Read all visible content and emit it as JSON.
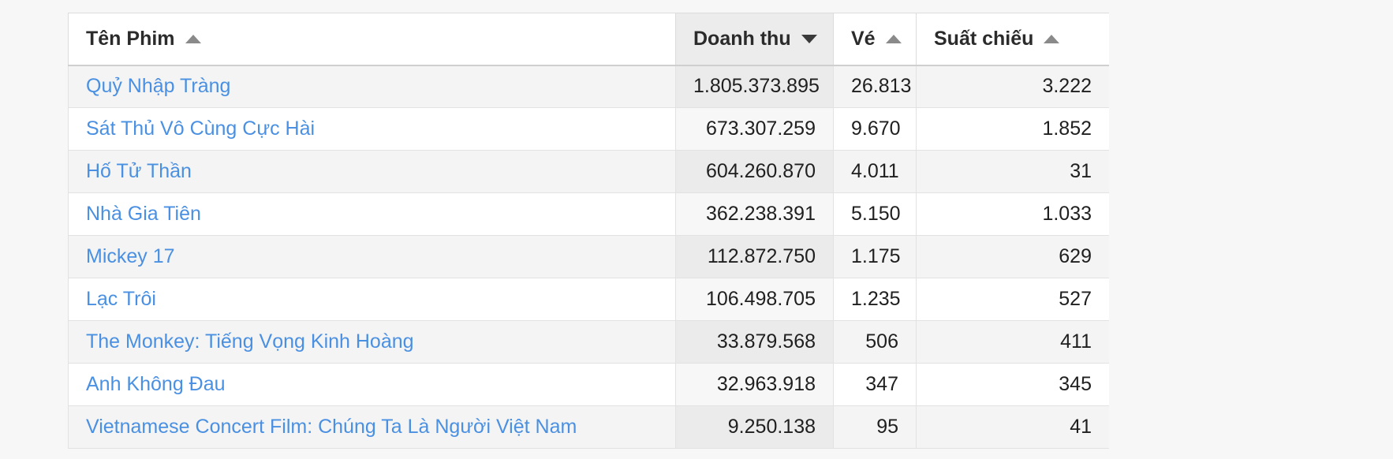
{
  "theme": {
    "page_background": "#f7f7f7",
    "link_color": "#4a90e2",
    "header_text_color": "#2b2b2b",
    "sorted_column_background": "#ececec",
    "stripe_color": "#f4f4f4",
    "border_color": "#e2e2e2"
  },
  "table": {
    "columns": [
      {
        "key": "name",
        "label": "Tên Phim",
        "align": "left",
        "sort": "asc",
        "sort_icon": "triangle-up-icon",
        "active_sort": false
      },
      {
        "key": "rev",
        "label": "Doanh thu",
        "align": "right",
        "sort": "desc",
        "sort_icon": "triangle-down-icon",
        "active_sort": true
      },
      {
        "key": "ticket",
        "label": "Vé",
        "align": "right",
        "sort": "asc",
        "sort_icon": "triangle-up-icon",
        "active_sort": false
      },
      {
        "key": "shows",
        "label": "Suất chiếu",
        "align": "right",
        "sort": "asc",
        "sort_icon": "triangle-up-icon",
        "active_sort": false
      }
    ],
    "rows": [
      {
        "name": "Quỷ Nhập Tràng",
        "rev": "1.805.373.895",
        "ticket": "26.813",
        "shows": "3.222"
      },
      {
        "name": "Sát Thủ Vô Cùng Cực Hài",
        "rev": "673.307.259",
        "ticket": "9.670",
        "shows": "1.852"
      },
      {
        "name": "Hố Tử Thần",
        "rev": "604.260.870",
        "ticket": "4.011",
        "shows": "31"
      },
      {
        "name": "Nhà Gia Tiên",
        "rev": "362.238.391",
        "ticket": "5.150",
        "shows": "1.033"
      },
      {
        "name": "Mickey 17",
        "rev": "112.872.750",
        "ticket": "1.175",
        "shows": "629"
      },
      {
        "name": "Lạc Trôi",
        "rev": "106.498.705",
        "ticket": "1.235",
        "shows": "527"
      },
      {
        "name": "The Monkey: Tiếng Vọng Kinh Hoàng",
        "rev": "33.879.568",
        "ticket": "506",
        "shows": "411"
      },
      {
        "name": "Anh Không Đau",
        "rev": "32.963.918",
        "ticket": "347",
        "shows": "345"
      },
      {
        "name": "Vietnamese Concert Film: Chúng Ta Là Người Việt Nam",
        "rev": "9.250.138",
        "ticket": "95",
        "shows": "41"
      }
    ]
  }
}
